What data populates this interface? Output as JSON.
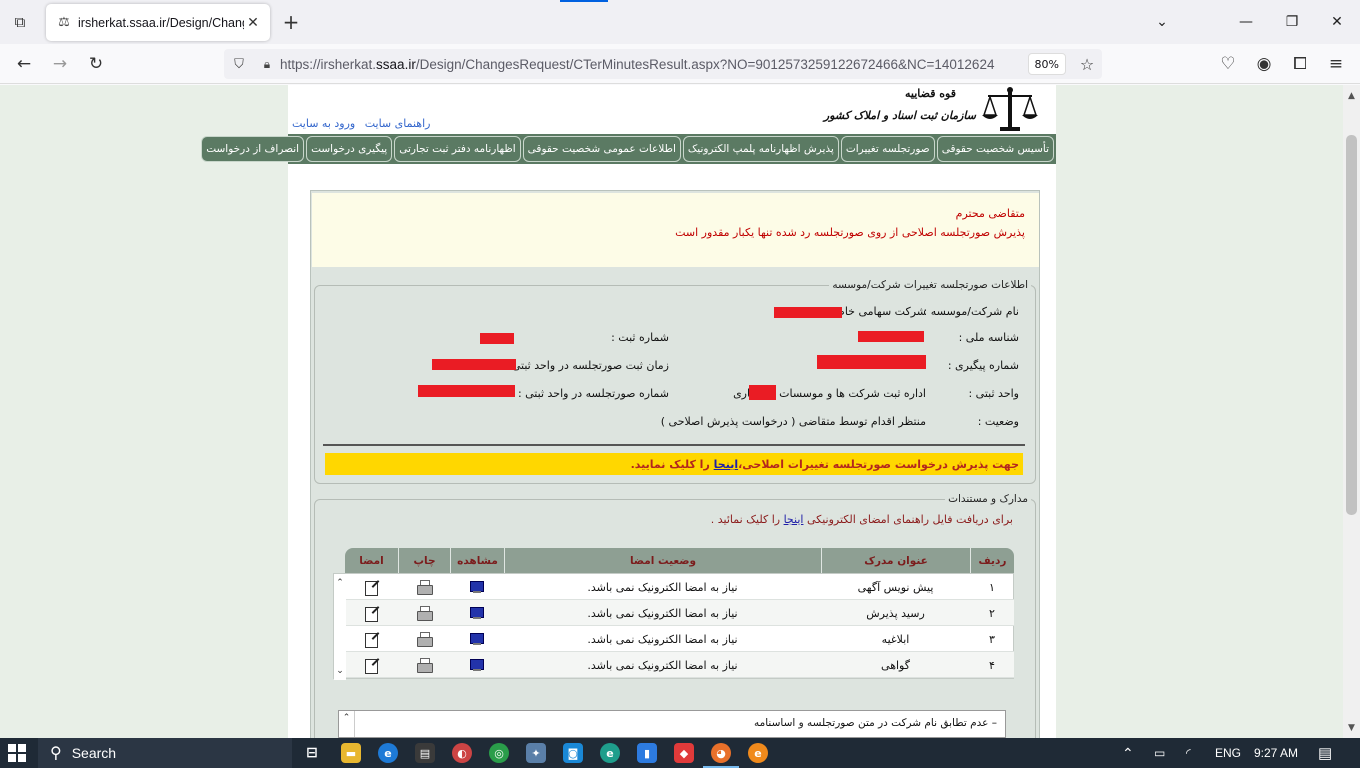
{
  "browser": {
    "tab_title": "irsherkat.ssaa.ir/Design/Changes",
    "url_host": "https://irsherkat.",
    "url_domain": "ssaa.ir",
    "url_path": "/Design/ChangesRequest/CTerMinutesResult.aspx?NO=9012573259122672466&NC=14012624",
    "zoom": "80%"
  },
  "site": {
    "org_name": "سازمان ثبت اسناد و املاک کشور",
    "org_sub": "قوه قضاییه",
    "top_links": [
      "ورود به سایت",
      "راهنمای سایت"
    ]
  },
  "menu": [
    "تأسیس شخصیت حقوقی",
    "صورتجلسه تغییرات",
    "پذیرش اظهارنامه پلمپ الکترونیک",
    "اطلاعات عمومی شخصیت حقوقی",
    "اظهارنامه دفتر ثبت تجارتی",
    "پیگیری درخواست",
    "انصراف از درخواست"
  ],
  "notice": {
    "line1": "متقاضی محترم",
    "line2": "پذیرش صورتجلسه اصلاحی از روی صورتجلسه رد شده تنها یکبار مقدور است"
  },
  "info": {
    "legend": "اطلاعات صورتجلسه تغییرات شرکت/موسسه",
    "company_name_label": "نام شرکت/موسسه :",
    "company_name_value": "شرکت سهامی خاص",
    "national_id_label": "شناسه ملی :",
    "reg_no_label": "شماره ثبت :",
    "tracking_no_label": "شماره پیگیری :",
    "minutes_time_label": "زمان ثبت صورتجلسه در واحد ثبتی :",
    "unit_label": "واحد ثبتی :",
    "unit_value": "اداره ثبت شرکت ها و موسسات غیرتجاری",
    "minutes_no_label": "شماره صورتجلسه در واحد ثبتی :",
    "status_label": "وضعیت :",
    "status_value": "منتظر اقدام توسط متقاضی ( درخواست پذیرش اصلاحی )"
  },
  "yellow_bar": {
    "before": "جهت پذیرش درخواست صورتجلسه تغییرات اصلاحی،",
    "link": "اینجا",
    "after": "را کلیک نمایید."
  },
  "docs": {
    "legend": "مدارک و مستندات",
    "hint_before": "برای دریافت فایل راهنمای امضای الکترونیکی",
    "hint_link": "اینجا",
    "hint_after": "را کلیک نمائید .",
    "headers": [
      "ردیف",
      "عنوان مدرک",
      "وضعیت امضا",
      "مشاهده",
      "چاپ",
      "امضا"
    ],
    "rows": [
      {
        "no": "۱",
        "title": "پیش نویس آگهی",
        "status": "نیاز به امضا الکترونیک نمی باشد."
      },
      {
        "no": "۲",
        "title": "رسید پذیرش",
        "status": "نیاز به امضا الکترونیک نمی باشد."
      },
      {
        "no": "۳",
        "title": "ابلاغیه",
        "status": "نیاز به امضا الکترونیک نمی باشد."
      },
      {
        "no": "۴",
        "title": "گواهی",
        "status": "نیاز به امضا الکترونیک نمی باشد."
      }
    ]
  },
  "bottom_panel": {
    "item": "– عدم تطابق نام شرکت در متن صورتجلسه و اساسنامه"
  },
  "taskbar": {
    "search": "Search",
    "lang": "ENG",
    "time": "9:27 AM"
  },
  "colors": {
    "menu_bg": "#5b7a63",
    "redaction": "#ea1c24",
    "highlight": "#ffd700",
    "notice_text": "#c00000"
  }
}
